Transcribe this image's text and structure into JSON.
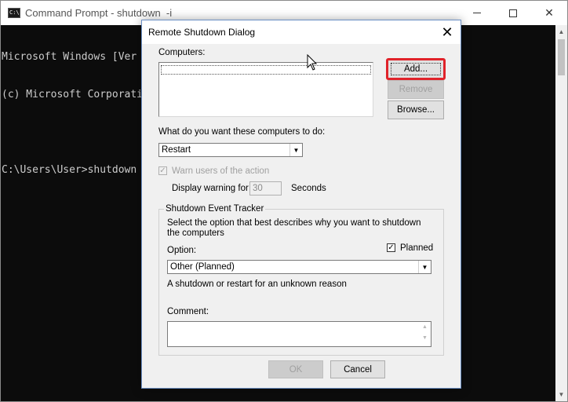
{
  "console": {
    "title": "Command Prompt - shutdown  -i",
    "icon": "cmd-icon",
    "lines": [
      "Microsoft Windows [Ver",
      "(c) Microsoft Corporati",
      "",
      "C:\\Users\\User>shutdown"
    ],
    "controls": {
      "minimize": "minimize-icon",
      "maximize": "maximize-icon",
      "close": "close-icon"
    }
  },
  "dialog": {
    "title": "Remote Shutdown Dialog",
    "computers_label": "Computers:",
    "buttons": {
      "add": "Add...",
      "remove": "Remove",
      "browse": "Browse..."
    },
    "action_label": "What do you want these computers to do:",
    "action_value": "Restart",
    "warn_label": "Warn users of the action",
    "warn_checked": true,
    "display_warning_label": "Display warning for",
    "display_warning_value": "30",
    "seconds_label": "Seconds",
    "tracker": {
      "title": "Shutdown Event Tracker",
      "description": "Select the option that best describes why you want to shutdown the computers",
      "option_label": "Option:",
      "planned_label": "Planned",
      "planned_checked": true,
      "option_value": "Other (Planned)",
      "option_description": "A shutdown or restart for an unknown reason",
      "comment_label": "Comment:"
    },
    "ok": "OK",
    "cancel": "Cancel"
  },
  "colors": {
    "highlight": "#e0232a",
    "console_bg": "#0c0c0c",
    "dialog_bg": "#f0f0f0"
  }
}
